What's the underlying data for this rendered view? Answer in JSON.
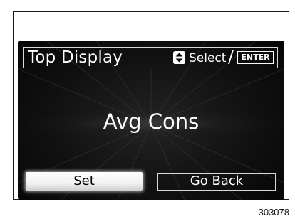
{
  "header": {
    "title": "Top Display",
    "select_label": "Select",
    "slash": "/",
    "enter_key": "ENTER",
    "updown_icon": "up-down-arrows-icon"
  },
  "display": {
    "value": "Avg Cons"
  },
  "buttons": {
    "set_label": "Set",
    "go_back_label": "Go Back"
  },
  "figure_id": "303078",
  "colors": {
    "screen_background": "#000000",
    "text": "#ffffff",
    "selected_button": "#f4f4f4",
    "outline": "#d8d8d8"
  }
}
